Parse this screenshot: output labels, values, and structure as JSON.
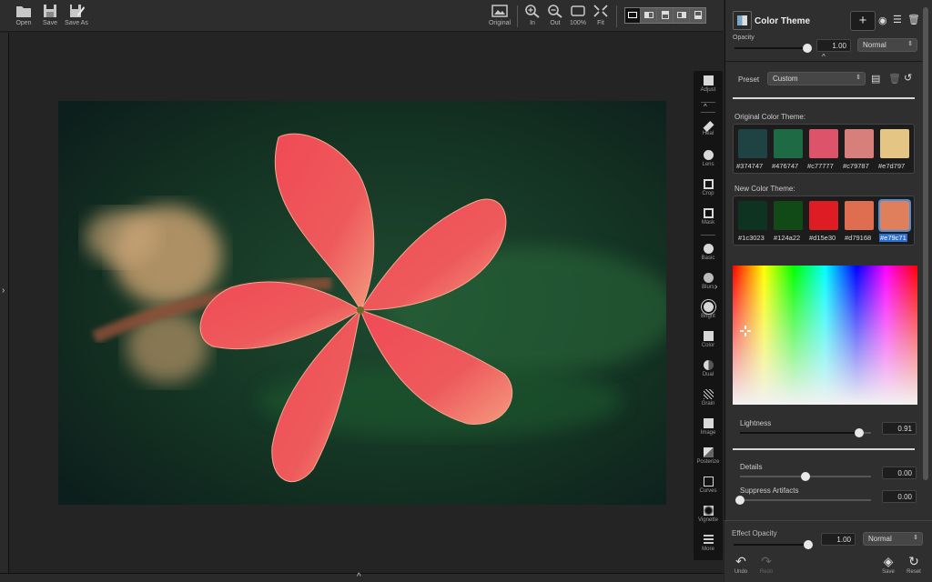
{
  "toolbar": {
    "open_label": "Open",
    "save_label": "Save",
    "save_as_label": "Save As",
    "original_label": "Original",
    "zoom_in_label": "In",
    "zoom_out_label": "Out",
    "zoom_100_label": "100%",
    "fit_label": "Fit"
  },
  "tools": [
    {
      "label": "Adjust",
      "icon": "adjust-icon"
    },
    {
      "label": "Heal",
      "icon": "bandage-icon"
    },
    {
      "label": "Lens",
      "icon": "lens-icon"
    },
    {
      "label": "Crop",
      "icon": "crop-icon"
    },
    {
      "label": "Mask",
      "icon": "mask-icon"
    },
    {
      "label": "Basic",
      "icon": "aperture-icon"
    },
    {
      "label": "Blurs",
      "icon": "blur-icon"
    },
    {
      "label": "Bright",
      "icon": "sun-icon"
    },
    {
      "label": "Color",
      "icon": "color-layers-icon"
    },
    {
      "label": "Dual",
      "icon": "half-circle-icon"
    },
    {
      "label": "Grain",
      "icon": "grain-icon"
    },
    {
      "label": "Image",
      "icon": "images-icon"
    },
    {
      "label": "Posterize",
      "icon": "posterize-icon"
    },
    {
      "label": "Curves",
      "icon": "curves-icon"
    },
    {
      "label": "Vignette",
      "icon": "vignette-icon"
    },
    {
      "label": "More",
      "icon": "sliders-icon"
    }
  ],
  "panel": {
    "title": "Color Theme",
    "opacity_label": "Opacity",
    "opacity_value": "1.00",
    "opacity_level": 1.0,
    "blend_mode": "Normal",
    "preset_label": "Preset",
    "preset_value": "Custom",
    "original_theme_label": "Original Color Theme:",
    "original_theme": [
      {
        "hex": "#374747",
        "color": "#1e4342"
      },
      {
        "hex": "#476747",
        "color": "#1d6a45"
      },
      {
        "hex": "#c77777",
        "color": "#dd5369"
      },
      {
        "hex": "#c79787",
        "color": "#d77f7a"
      },
      {
        "hex": "#e7d797",
        "color": "#e4c584"
      }
    ],
    "new_theme_label": "New Color Theme:",
    "new_theme": [
      {
        "hex": "#1c3023",
        "color": "#0f3321"
      },
      {
        "hex": "#124a22",
        "color": "#124a17"
      },
      {
        "hex": "#d15e30",
        "color": "#dd1c24"
      },
      {
        "hex": "#d79168",
        "color": "#de6e4f"
      },
      {
        "hex": "#e79c71",
        "color": "#e07f5b"
      }
    ],
    "lightness_label": "Lightness",
    "lightness_value": "0.91",
    "lightness_level": 0.91,
    "details_label": "Details",
    "details_value": "0.00",
    "details_level": 0.5,
    "suppress_label": "Suppress Artifacts",
    "suppress_value": "0.00",
    "suppress_level": 0.0
  },
  "footer": {
    "effect_opacity_label": "Effect Opacity",
    "effect_opacity_value": "1.00",
    "effect_opacity_level": 1.0,
    "blend_mode": "Normal",
    "undo_label": "Undo",
    "redo_label": "Redo",
    "save_label": "Save",
    "reset_label": "Reset"
  }
}
